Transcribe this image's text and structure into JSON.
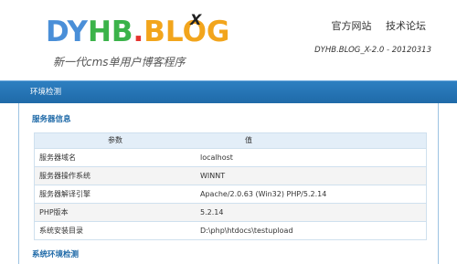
{
  "header": {
    "logo": {
      "letters": [
        "DY",
        "HB",
        ".",
        "BLOG"
      ],
      "badge": "X",
      "slogan": "新一代cms单用户博客程序"
    },
    "links": [
      {
        "label": "官方网站"
      },
      {
        "label": "技术论坛"
      }
    ],
    "version": "DYHB.BLOG_X-2.0 - 20120313"
  },
  "nav": {
    "title": "环境检测"
  },
  "server_info": {
    "title": "服务器信息",
    "columns": [
      "参数",
      "值"
    ],
    "rows": [
      {
        "param": "服务器域名",
        "value": "localhost"
      },
      {
        "param": "服务器操作系统",
        "value": "WINNT"
      },
      {
        "param": "服务器解译引擎",
        "value": "Apache/2.0.63 (Win32) PHP/5.2.14"
      },
      {
        "param": "PHP版本",
        "value": "5.2.14"
      },
      {
        "param": "系统安装目录",
        "value": "D:\\php\\htdocs\\testupload"
      }
    ]
  },
  "env_check": {
    "title": "系统环境检测"
  },
  "colors": {
    "nav_blue": "#1f6aa8",
    "title_blue": "#1f6aa8",
    "table_border": "#cfe0ee",
    "header_bg": "#e3eef8"
  }
}
